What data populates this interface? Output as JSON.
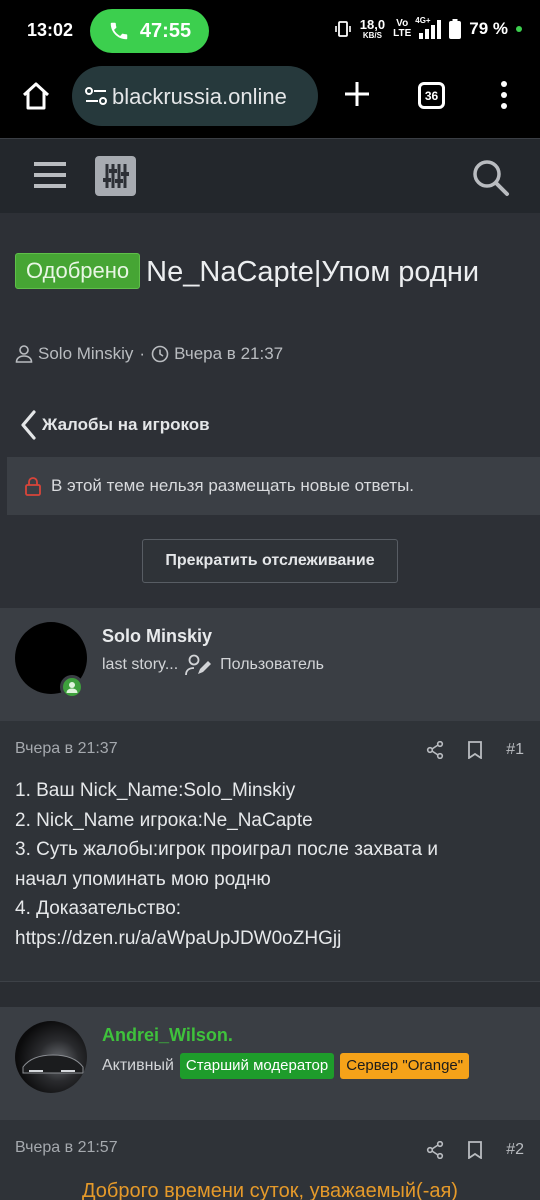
{
  "status_bar": {
    "time": "13:02",
    "call_timer": "47:55",
    "speed_value": "18,0",
    "speed_unit": "KB/S",
    "volte_top": "Vo",
    "volte_bottom": "LTE",
    "network": "4G+",
    "battery": "79 %"
  },
  "browser": {
    "url": "blackrussia.online",
    "tab_count": "36"
  },
  "thread": {
    "prefix": "Одобрено",
    "title": "Ne_NaCapte|Упом родни",
    "author": "Solo Minskiy",
    "separator": "·",
    "date": "Вчера в 21:37",
    "back_label": "Жалобы на игроков",
    "locked_notice": "В этой теме нельзя размещать новые ответы.",
    "unwatch_label": "Прекратить отслеживание"
  },
  "posts": [
    {
      "author": "Solo Minskiy",
      "user_title": "last story...",
      "role": "Пользователь",
      "date": "Вчера в 21:37",
      "number": "#1",
      "lines": [
        "1. Ваш Nick_Name:Solo_Minskiy",
        "2. Nick_Name игрока:Ne_NaCapte",
        "3. Суть жалобы:игрок проиграл после захвата и",
        "начал упоминать мою родню",
        "4. Доказательство:",
        "https://dzen.ru/a/aWpaUpJDW0oZHGjj"
      ]
    },
    {
      "author": "Andrei_Wilson.",
      "user_title": "Активный",
      "badge_moderator": "Старший модератор",
      "badge_server": "Сервер \"Orange\"",
      "date": "Вчера в 21:57",
      "number": "#2",
      "first_line": "Доброго времени суток, уважаемый(-ая)"
    }
  ],
  "colors": {
    "approved": "#46a534",
    "moderator_badge": "#1e9c2b",
    "server_badge": "#f5a219",
    "username_green": "#3fc23c",
    "reply_orange": "#e59a2a"
  }
}
